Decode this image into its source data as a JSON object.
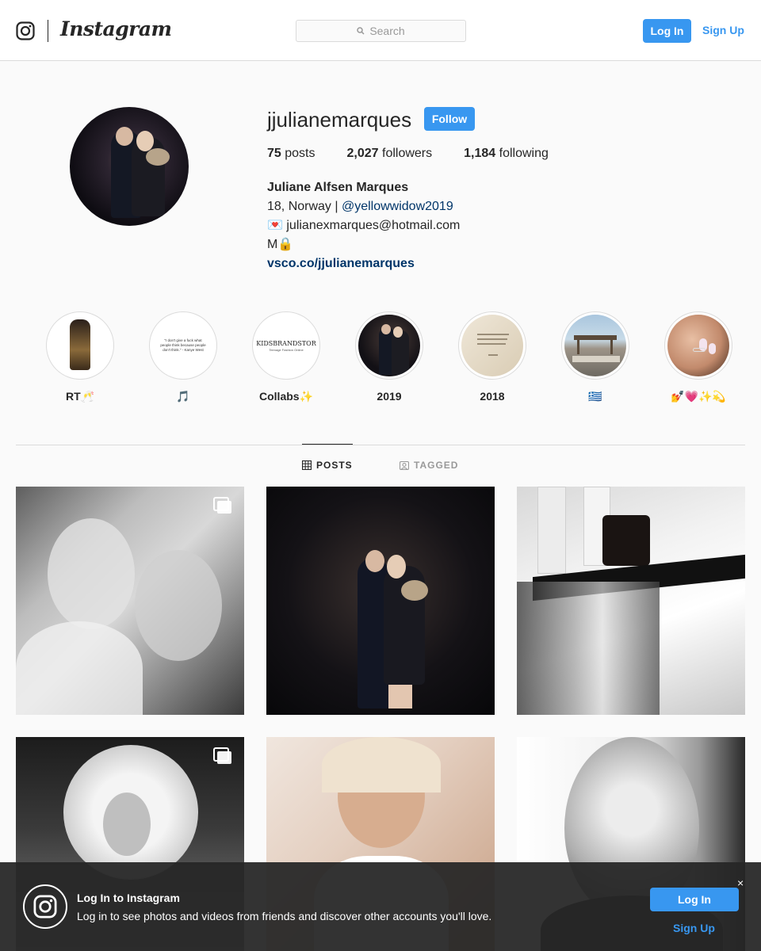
{
  "nav": {
    "brand": "Instagram",
    "search_placeholder": "Search",
    "login_label": "Log In",
    "signup_label": "Sign Up"
  },
  "profile": {
    "username": "jjulianemarques",
    "follow_label": "Follow",
    "posts_count": "75",
    "posts_word": "posts",
    "followers_count": "2,027",
    "followers_word": "followers",
    "following_count": "1,184",
    "following_word": "following",
    "full_name": "Juliane Alfsen Marques",
    "bio_line1_prefix": "18, Norway | ",
    "bio_line1_mention": "@yellowwidow2019",
    "bio_line2": "💌 julianexmarques@hotmail.com",
    "bio_line3": "M🔒",
    "website": "vsco.co/jjulianemarques"
  },
  "highlights": [
    {
      "label": "RT🥂"
    },
    {
      "label": "🎵"
    },
    {
      "label": "Collabs✨"
    },
    {
      "label": "2019"
    },
    {
      "label": "2018"
    },
    {
      "label": "🇬🇷"
    },
    {
      "label": "💅💗✨💫"
    }
  ],
  "highlight_texts": {
    "kanye_quote": "\"I don't give a fuck what people think because people don't think.\" - Kanye West",
    "kids_brand": "KIDSBRANDSTOR",
    "kids_brand_sub": "Teenage Fashion Online"
  },
  "tabs": {
    "posts": "POSTS",
    "tagged": "TAGGED"
  },
  "banner": {
    "title": "Log In to Instagram",
    "text": "Log in to see photos and videos from friends and discover other accounts you'll love.",
    "login_label": "Log In",
    "signup_label": "Sign Up",
    "close": "×"
  },
  "colors": {
    "accent": "#3897f0",
    "link": "#003569",
    "border": "#dbdbdb",
    "text": "#262626",
    "muted": "#999999"
  }
}
